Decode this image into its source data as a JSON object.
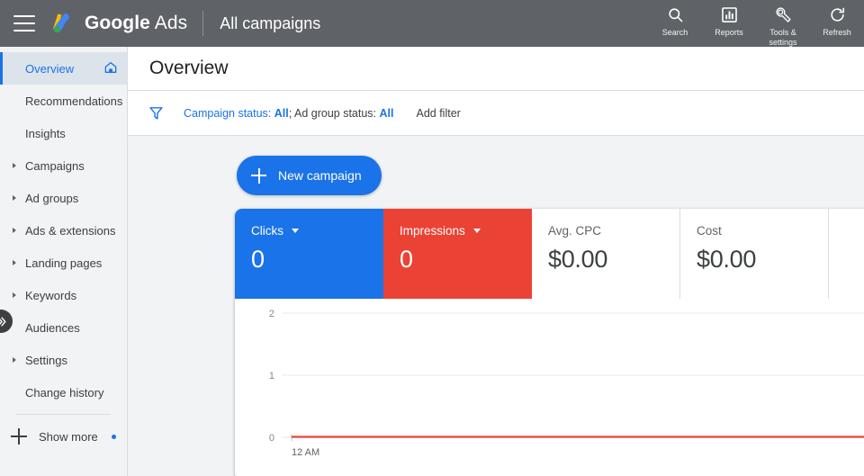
{
  "header": {
    "menu_icon": "hamburger-menu-icon",
    "logo_icon": "google-ads-logo",
    "brand_bold": "Google",
    "brand_light": "Ads",
    "page_context": "All campaigns",
    "actions": [
      {
        "label": "Search",
        "icon": "search-icon"
      },
      {
        "label": "Reports",
        "icon": "reports-bar-chart-icon"
      },
      {
        "label": "Tools &\nsettings",
        "label_line1": "Tools &",
        "label_line2": "settings",
        "icon": "wrench-tools-icon"
      },
      {
        "label": "Refresh",
        "icon": "refresh-icon"
      }
    ]
  },
  "sidebar": {
    "items": [
      {
        "label": "Overview",
        "selected": true,
        "expandable": false,
        "trailing_icon": "home-icon"
      },
      {
        "label": "Recommendations",
        "selected": false,
        "expandable": false
      },
      {
        "label": "Insights",
        "selected": false,
        "expandable": false
      },
      {
        "label": "Campaigns",
        "selected": false,
        "expandable": true
      },
      {
        "label": "Ad groups",
        "selected": false,
        "expandable": true
      },
      {
        "label": "Ads & extensions",
        "selected": false,
        "expandable": true
      },
      {
        "label": "Landing pages",
        "selected": false,
        "expandable": true
      },
      {
        "label": "Keywords",
        "selected": false,
        "expandable": true
      },
      {
        "label": "Audiences",
        "selected": false,
        "expandable": false
      },
      {
        "label": "Settings",
        "selected": false,
        "expandable": true
      },
      {
        "label": "Change history",
        "selected": false,
        "expandable": false
      }
    ],
    "show_more": {
      "label": "Show more",
      "icon": "plus-icon",
      "badge_dot": true
    },
    "expander_icon": "double-chevron-right-icon"
  },
  "main": {
    "page_title": "Overview",
    "filter": {
      "icon": "filter-funnel-icon",
      "chip_prefix": "Campaign status: ",
      "chip_value_1": "All",
      "chip_middle": "; Ad group status: ",
      "chip_value_2": "All",
      "add_filter_label": "Add filter"
    },
    "new_campaign_label": "New campaign",
    "cards": [
      {
        "label": "Clicks",
        "value": "0",
        "style": "blue",
        "has_dropdown": true
      },
      {
        "label": "Impressions",
        "value": "0",
        "style": "red",
        "has_dropdown": true
      },
      {
        "label": "Avg. CPC",
        "value": "$0.00",
        "style": "plain",
        "has_dropdown": false
      },
      {
        "label": "Cost",
        "value": "$0.00",
        "style": "plain",
        "has_dropdown": false
      }
    ]
  },
  "colors": {
    "header_bg": "#5f6368",
    "accent_blue": "#1a73e8",
    "accent_red": "#ea4335",
    "canvas_bg": "#f1f3f4",
    "sidebar_bg": "#f1f3f4",
    "text_primary": "#202124",
    "text_secondary": "#5f6368"
  },
  "chart_data": {
    "type": "line",
    "title": "",
    "xlabel": "",
    "ylabel": "",
    "x": [
      "12 AM"
    ],
    "x_tick_labels": [
      "12 AM"
    ],
    "y_tick_labels": [
      "0",
      "1",
      "2"
    ],
    "ylim": [
      0,
      2
    ],
    "grid": true,
    "legend": "none",
    "series": [
      {
        "name": "Impressions",
        "color": "#ea4335",
        "values": [
          0,
          0
        ]
      }
    ]
  }
}
